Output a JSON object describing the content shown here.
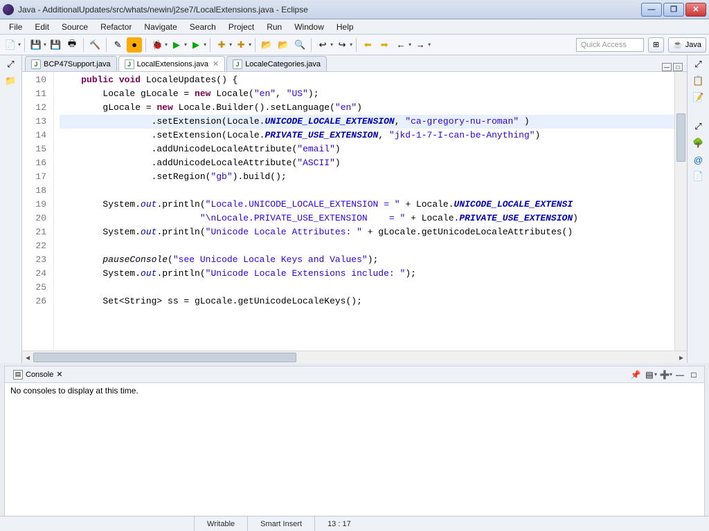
{
  "window": {
    "title": "Java - AdditionalUpdates/src/whats/newin/j2se7/LocalExtensions.java - Eclipse"
  },
  "menu": [
    "File",
    "Edit",
    "Source",
    "Refactor",
    "Navigate",
    "Search",
    "Project",
    "Run",
    "Window",
    "Help"
  ],
  "quick_access_placeholder": "Quick Access",
  "perspective_label": "Java",
  "tabs": [
    {
      "label": "BCP47Support.java",
      "active": false,
      "closable": false
    },
    {
      "label": "LocalExtensions.java",
      "active": true,
      "closable": true
    },
    {
      "label": "LocaleCategories.java",
      "active": false,
      "closable": false
    }
  ],
  "code": {
    "first_line": 10,
    "highlight_line": 13,
    "lines": [
      [
        [
          "pad",
          "    "
        ],
        [
          "kw",
          "public"
        ],
        [
          "txt",
          " "
        ],
        [
          "kw",
          "void"
        ],
        [
          "txt",
          " LocaleUpdates() {"
        ]
      ],
      [
        [
          "pad",
          "        "
        ],
        [
          "txt",
          "Locale gLocale = "
        ],
        [
          "kw",
          "new"
        ],
        [
          "txt",
          " Locale("
        ],
        [
          "str",
          "\"en\""
        ],
        [
          "txt",
          ", "
        ],
        [
          "str",
          "\"US\""
        ],
        [
          "txt",
          ");"
        ]
      ],
      [
        [
          "pad",
          "        "
        ],
        [
          "txt",
          "gLocale = "
        ],
        [
          "kw",
          "new"
        ],
        [
          "txt",
          " Locale.Builder().setLanguage("
        ],
        [
          "str",
          "\"en\""
        ],
        [
          "txt",
          ")"
        ]
      ],
      [
        [
          "pad",
          "                 "
        ],
        [
          "txt",
          ".setExtension(Locale."
        ],
        [
          "constf",
          "UNICODE_LOCALE_EXTENSION"
        ],
        [
          "txt",
          ", "
        ],
        [
          "str",
          "\"ca-gregory-nu-roman\""
        ],
        [
          "txt",
          " )"
        ]
      ],
      [
        [
          "pad",
          "                 "
        ],
        [
          "txt",
          ".setExtension(Locale."
        ],
        [
          "constf",
          "PRIVATE_USE_EXTENSION"
        ],
        [
          "txt",
          ", "
        ],
        [
          "str",
          "\"jkd-1-7-I-can-be-Anything\""
        ],
        [
          "txt",
          ")"
        ]
      ],
      [
        [
          "pad",
          "                 "
        ],
        [
          "txt",
          ".addUnicodeLocaleAttribute("
        ],
        [
          "str",
          "\"email\""
        ],
        [
          "txt",
          ")"
        ]
      ],
      [
        [
          "pad",
          "                 "
        ],
        [
          "txt",
          ".addUnicodeLocaleAttribute("
        ],
        [
          "str",
          "\"ASCII\""
        ],
        [
          "txt",
          ")"
        ]
      ],
      [
        [
          "pad",
          "                 "
        ],
        [
          "txt",
          ".setRegion("
        ],
        [
          "str",
          "\"gb\""
        ],
        [
          "txt",
          ").build();"
        ]
      ],
      [
        [
          "txt",
          ""
        ]
      ],
      [
        [
          "pad",
          "        "
        ],
        [
          "txt",
          "System."
        ],
        [
          "field",
          "out"
        ],
        [
          "txt",
          ".println("
        ],
        [
          "str",
          "\"Locale.UNICODE_LOCALE_EXTENSION = \""
        ],
        [
          "txt",
          " + Locale."
        ],
        [
          "constf",
          "UNICODE_LOCALE_EXTENSI"
        ]
      ],
      [
        [
          "pad",
          "                          "
        ],
        [
          "str",
          "\"\\nLocale.PRIVATE_USE_EXTENSION    = \""
        ],
        [
          "txt",
          " + Locale."
        ],
        [
          "constf",
          "PRIVATE_USE_EXTENSION"
        ],
        [
          "txt",
          ")"
        ]
      ],
      [
        [
          "pad",
          "        "
        ],
        [
          "txt",
          "System."
        ],
        [
          "field",
          "out"
        ],
        [
          "txt",
          ".println("
        ],
        [
          "str",
          "\"Unicode Locale Attributes: \""
        ],
        [
          "txt",
          " + gLocale.getUnicodeLocaleAttributes()"
        ]
      ],
      [
        [
          "txt",
          ""
        ]
      ],
      [
        [
          "pad",
          "        "
        ],
        [
          "mtd",
          "pauseConsole"
        ],
        [
          "txt",
          "("
        ],
        [
          "str",
          "\"see Unicode Locale Keys and Values\""
        ],
        [
          "txt",
          ");"
        ]
      ],
      [
        [
          "pad",
          "        "
        ],
        [
          "txt",
          "System."
        ],
        [
          "field",
          "out"
        ],
        [
          "txt",
          ".println("
        ],
        [
          "str",
          "\"Unicode Locale Extensions include: \""
        ],
        [
          "txt",
          ");"
        ]
      ],
      [
        [
          "txt",
          ""
        ]
      ],
      [
        [
          "pad",
          "        "
        ],
        [
          "txt",
          "Set<String> ss = gLocale.getUnicodeLocaleKeys();"
        ]
      ]
    ]
  },
  "console": {
    "tab_label": "Console",
    "body": "No consoles to display at this time."
  },
  "status": {
    "writable": "Writable",
    "insert_mode": "Smart Insert",
    "cursor": "13 : 17"
  }
}
